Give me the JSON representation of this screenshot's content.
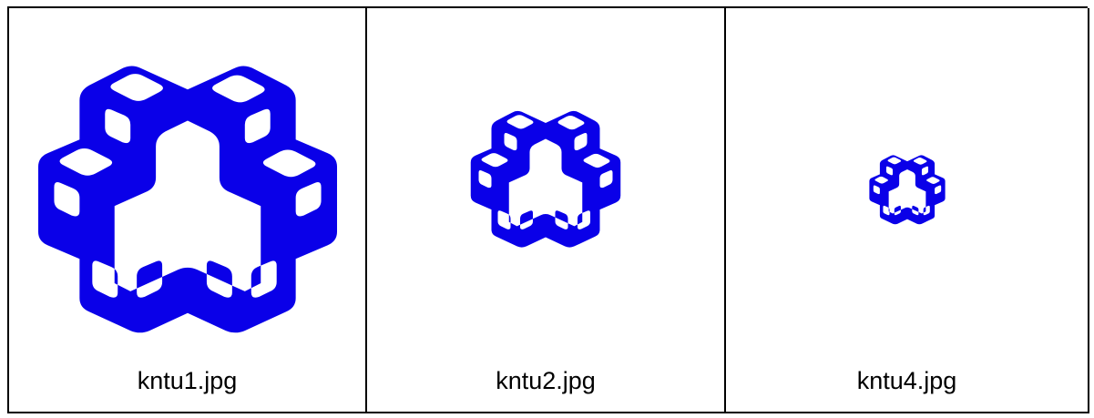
{
  "logo_color": "#0a00e8",
  "cells": [
    {
      "caption": "kntu1.jpg",
      "image_icon": "kntu-logo-icon"
    },
    {
      "caption": "kntu2.jpg",
      "image_icon": "kntu-logo-icon"
    },
    {
      "caption": "kntu4.jpg",
      "image_icon": "kntu-logo-icon"
    }
  ]
}
